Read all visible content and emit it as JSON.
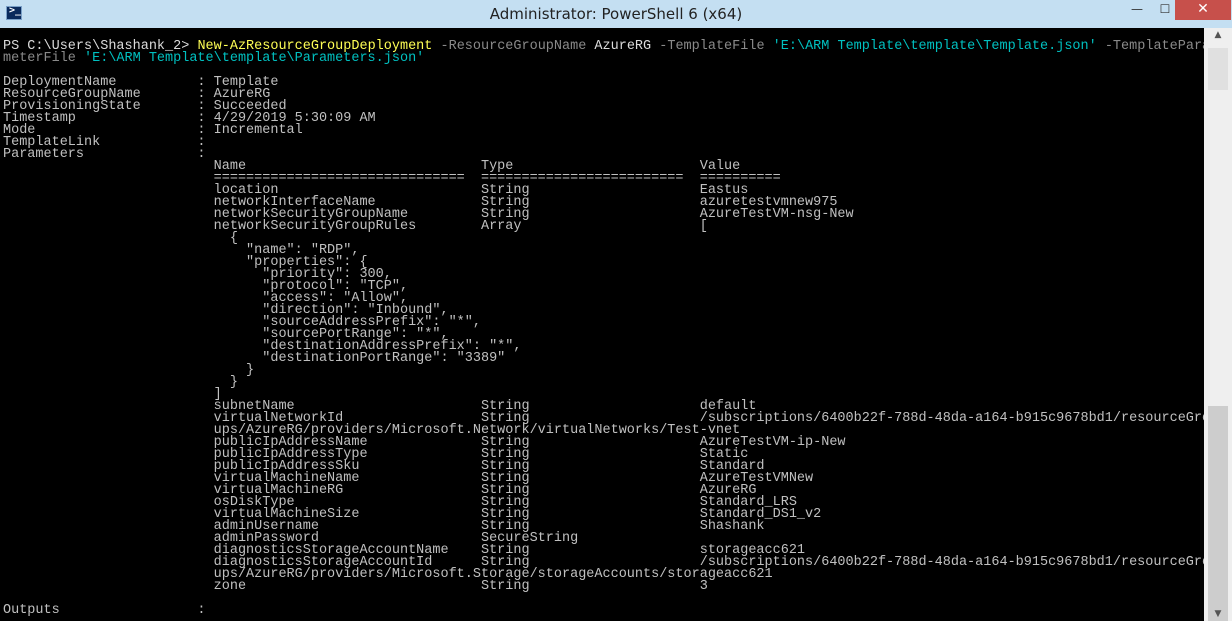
{
  "window": {
    "title": "Administrator: PowerShell 6 (x64)",
    "icon": "powershell-icon",
    "minimize_glyph": "—",
    "maximize_glyph": "☐",
    "close_glyph": "✕"
  },
  "command": {
    "prompt": "PS C:\\Users\\Shashank_2> ",
    "cmdlet": "New-AzResourceGroupDeployment",
    "param1": " -ResourceGroupName ",
    "rg_value": "AzureRG",
    "param2": " -TemplateFile ",
    "template_path": "'E:\\ARM Template\\template\\Template.json'",
    "param3": " -TemplatePara\nmeterFile ",
    "params_path": "'E:\\ARM Template\\template\\Parameters.json'"
  },
  "output": "\n\nDeploymentName          : Template\nResourceGroupName       : AzureRG\nProvisioningState       : Succeeded\nTimestamp               : 4/29/2019 5:30:09 AM\nMode                    : Incremental\nTemplateLink            :\nParameters              :\n                          Name                             Type                       Value\n                          ===============================  =========================  ==========\n                          location                         String                     Eastus\n                          networkInterfaceName             String                     azuretestvmnew975\n                          networkSecurityGroupName         String                     AzureTestVM-nsg-New\n                          networkSecurityGroupRules        Array                      [\n                            {\n                              \"name\": \"RDP\",\n                              \"properties\": {\n                                \"priority\": 300,\n                                \"protocol\": \"TCP\",\n                                \"access\": \"Allow\",\n                                \"direction\": \"Inbound\",\n                                \"sourceAddressPrefix\": \"*\",\n                                \"sourcePortRange\": \"*\",\n                                \"destinationAddressPrefix\": \"*\",\n                                \"destinationPortRange\": \"3389\"\n                              }\n                            }\n                          ]\n                          subnetName                       String                     default\n                          virtualNetworkId                 String                     /subscriptions/6400b22f-788d-48da-a164-b915c9678bd1/resourceGro\n                          ups/AzureRG/providers/Microsoft.Network/virtualNetworks/Test-vnet\n                          publicIpAddressName              String                     AzureTestVM-ip-New\n                          publicIpAddressType              String                     Static\n                          publicIpAddressSku               String                     Standard\n                          virtualMachineName               String                     AzureTestVMNew\n                          virtualMachineRG                 String                     AzureRG\n                          osDiskType                       String                     Standard_LRS\n                          virtualMachineSize               String                     Standard_DS1_v2\n                          adminUsername                    String                     Shashank\n                          adminPassword                    SecureString\n                          diagnosticsStorageAccountName    String                     storageacc621\n                          diagnosticsStorageAccountId      String                     /subscriptions/6400b22f-788d-48da-a164-b915c9678bd1/resourceGro\n                          ups/AzureRG/providers/Microsoft.Storage/storageAccounts/storageacc621\n                          zone                             String                     3\n\nOutputs                 :",
  "scrollbar": {
    "up_glyph": "▲",
    "down_glyph": "▼"
  }
}
